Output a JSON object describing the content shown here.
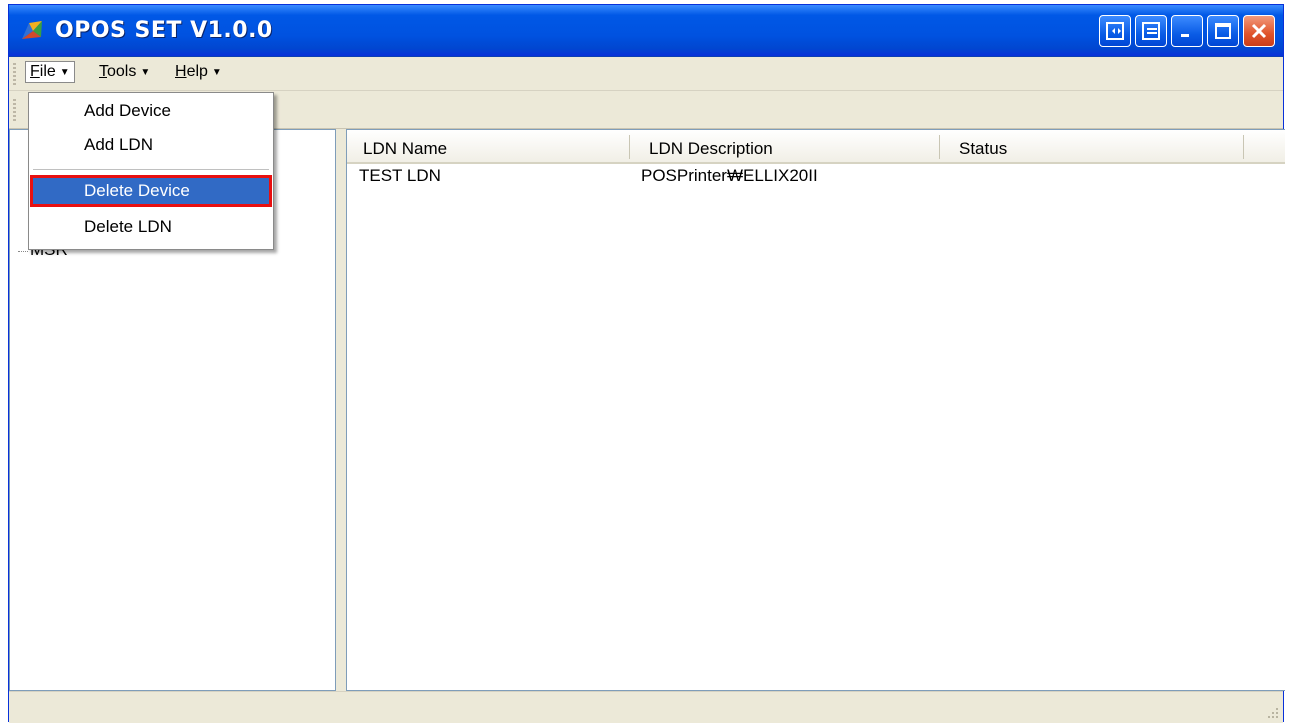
{
  "window": {
    "title": "OPOS SET V1.0.0",
    "app_icon": "app-logo-icon",
    "buttons": [
      "restore-side-icon",
      "dock-icon",
      "minimize-icon",
      "maximize-icon",
      "close-icon"
    ]
  },
  "menubar": {
    "file": {
      "label": "File",
      "accel": "F",
      "rest": "ile"
    },
    "tools": {
      "label": "Tools",
      "accel": "T",
      "rest": "ools"
    },
    "help": {
      "label": "Help",
      "accel": "H",
      "rest": "elp"
    }
  },
  "file_menu": {
    "items": [
      {
        "label": "Add Device"
      },
      {
        "label": "Add LDN"
      },
      {
        "label": "Delete Device",
        "selected": true
      },
      {
        "label": "Delete LDN"
      }
    ]
  },
  "tree": {
    "nodes": [
      {
        "label": "MSR"
      }
    ]
  },
  "list": {
    "columns": [
      "LDN Name",
      "LDN Description",
      "Status"
    ],
    "rows": [
      {
        "name": "TEST LDN",
        "description": "POSPrinter₩ELLIX20II",
        "status": ""
      }
    ]
  },
  "colors": {
    "titlebar": "#0058E6",
    "highlight": "#316AC5",
    "annotation": "#E81010",
    "chrome": "#ECE9D8"
  }
}
